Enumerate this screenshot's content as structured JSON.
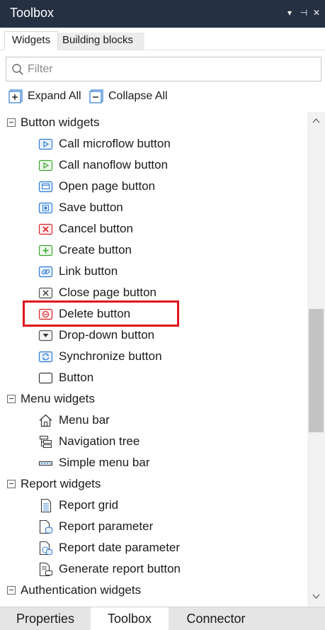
{
  "panel": {
    "title": "Toolbox",
    "controls": {
      "dropdown": "▾",
      "pin": "⊣",
      "close": "✕"
    }
  },
  "tabs": [
    {
      "label": "Widgets",
      "active": true
    },
    {
      "label": "Building blocks",
      "active": false
    }
  ],
  "filter": {
    "placeholder": "Filter",
    "value": ""
  },
  "actions": {
    "expand_all": "Expand All",
    "collapse_all": "Collapse All"
  },
  "tree": {
    "groups": [
      {
        "label": "Button widgets",
        "items": [
          {
            "label": "Call microflow button",
            "icon": "call-microflow-icon"
          },
          {
            "label": "Call nanoflow button",
            "icon": "call-nanoflow-icon"
          },
          {
            "label": "Open page button",
            "icon": "open-page-icon"
          },
          {
            "label": "Save button",
            "icon": "save-icon"
          },
          {
            "label": "Cancel button",
            "icon": "cancel-icon"
          },
          {
            "label": "Create button",
            "icon": "create-icon"
          },
          {
            "label": "Link button",
            "icon": "link-icon"
          },
          {
            "label": "Close page button",
            "icon": "close-page-icon"
          },
          {
            "label": "Delete button",
            "icon": "delete-icon"
          },
          {
            "label": "Drop-down button",
            "icon": "drop-down-icon"
          },
          {
            "label": "Synchronize button",
            "icon": "synchronize-icon"
          },
          {
            "label": "Button",
            "icon": "button-icon"
          }
        ]
      },
      {
        "label": "Menu widgets",
        "items": [
          {
            "label": "Menu bar",
            "icon": "menu-bar-icon"
          },
          {
            "label": "Navigation tree",
            "icon": "navigation-tree-icon"
          },
          {
            "label": "Simple menu bar",
            "icon": "simple-menu-bar-icon"
          }
        ]
      },
      {
        "label": "Report widgets",
        "items": [
          {
            "label": "Report grid",
            "icon": "report-grid-icon"
          },
          {
            "label": "Report parameter",
            "icon": "report-parameter-icon"
          },
          {
            "label": "Report date parameter",
            "icon": "report-date-parameter-icon"
          },
          {
            "label": "Generate report button",
            "icon": "generate-report-icon"
          }
        ]
      },
      {
        "label": "Authentication widgets",
        "items": []
      }
    ],
    "highlighted_item": "Delete button"
  },
  "bottom_tabs": [
    {
      "label": "Properties",
      "active": false
    },
    {
      "label": "Toolbox",
      "active": true
    },
    {
      "label": "Connector",
      "active": false
    }
  ],
  "colors": {
    "titlebar_bg": "#253042",
    "highlight_border": "#e0141e",
    "icon_blue": "#2f7bd6",
    "icon_green": "#3aa62c",
    "icon_red": "#d9252c"
  }
}
